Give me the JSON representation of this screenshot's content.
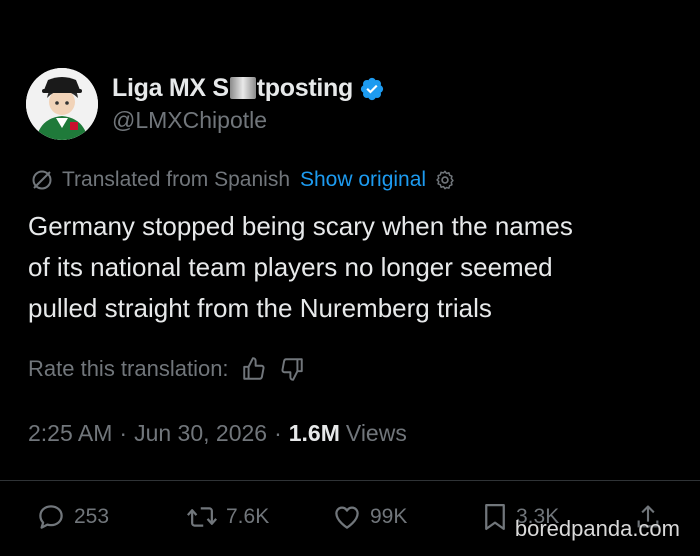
{
  "user": {
    "display_name_prefix": "Liga MX S",
    "display_name_suffix": "tposting",
    "handle": "@LMXChipotle",
    "avatar_icon": "avatar-icon",
    "verified_color": "#1d9bf0"
  },
  "translation": {
    "label": "Translated from Spanish",
    "show_original": "Show original",
    "gear_icon": "gear-icon"
  },
  "tweet": {
    "lines": [
      "Germany stopped being scary when the names",
      "of its national team players no longer seemed",
      "pulled straight from the Nuremberg trials"
    ]
  },
  "rate": {
    "label": "Rate this translation:"
  },
  "meta": {
    "time": "2:25 AM",
    "date": "Jun 30, 2026",
    "views_count": "1.6M",
    "views_label": "Views"
  },
  "actions": {
    "replies": "253",
    "reposts": "7.6K",
    "likes": "99K",
    "bookmarks": "3.3K"
  },
  "watermark": "boredpanda.com",
  "colors": {
    "background": "#000000",
    "text": "#e7e9ea",
    "muted": "#71767b",
    "accent": "#1d9bf0"
  }
}
